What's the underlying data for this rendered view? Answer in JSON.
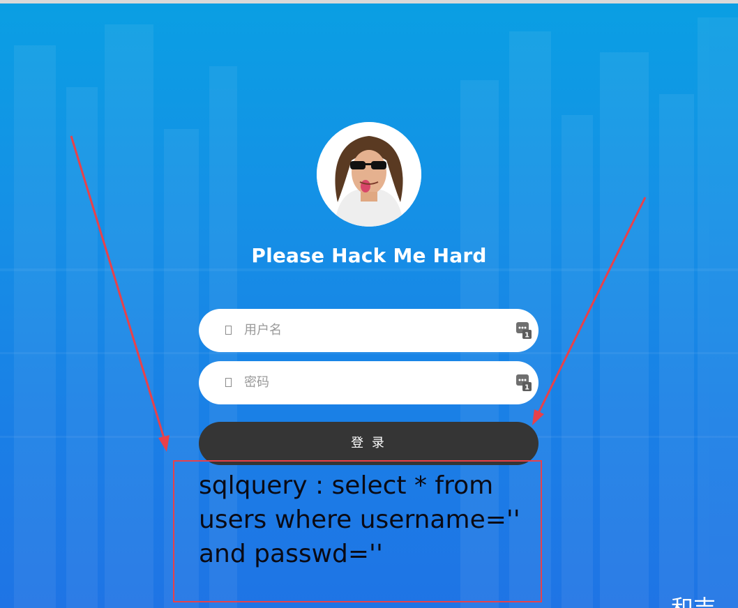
{
  "login": {
    "title": "Please Hack Me Hard",
    "username_placeholder": "用户名",
    "password_placeholder": "密码",
    "submit_label": "登 录"
  },
  "annotation": {
    "sql_query": "sqlquery : select * from users where username='' and passwd=''",
    "box_color": "#e8414a",
    "arrow_color": "#e8414a"
  },
  "corner_text": "和吉",
  "colors": {
    "background_top": "#0a9fe3",
    "background_bottom": "#1f74e5",
    "button": "#353535",
    "field": "#ffffff",
    "title": "#ffffff"
  },
  "icons": {
    "avatar": "avatar-photo",
    "field_lead": "field-glyph-icon",
    "field_tail": "password-manager-key-icon"
  }
}
